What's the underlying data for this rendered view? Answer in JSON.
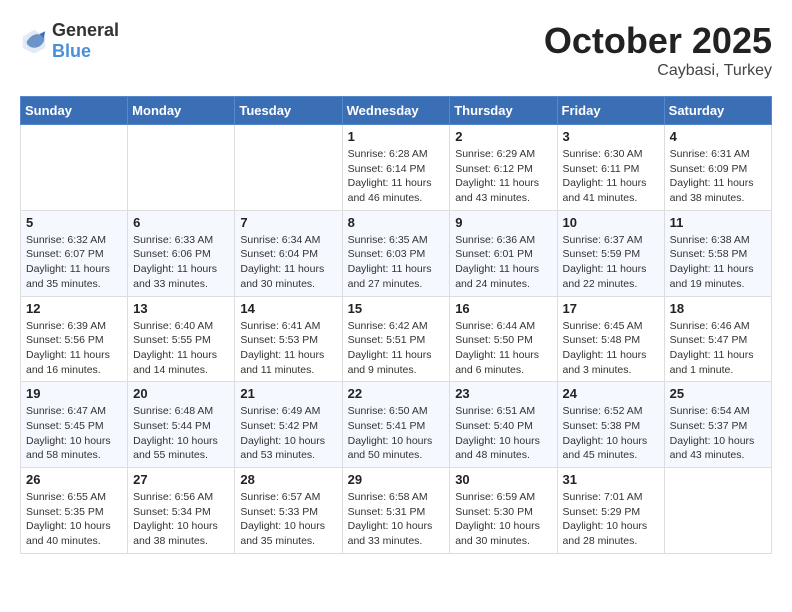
{
  "logo": {
    "general": "General",
    "blue": "Blue"
  },
  "header": {
    "month": "October 2025",
    "location": "Caybasi, Turkey"
  },
  "weekdays": [
    "Sunday",
    "Monday",
    "Tuesday",
    "Wednesday",
    "Thursday",
    "Friday",
    "Saturday"
  ],
  "weeks": [
    [
      {
        "day": "",
        "info": ""
      },
      {
        "day": "",
        "info": ""
      },
      {
        "day": "",
        "info": ""
      },
      {
        "day": "1",
        "info": "Sunrise: 6:28 AM\nSunset: 6:14 PM\nDaylight: 11 hours and 46 minutes."
      },
      {
        "day": "2",
        "info": "Sunrise: 6:29 AM\nSunset: 6:12 PM\nDaylight: 11 hours and 43 minutes."
      },
      {
        "day": "3",
        "info": "Sunrise: 6:30 AM\nSunset: 6:11 PM\nDaylight: 11 hours and 41 minutes."
      },
      {
        "day": "4",
        "info": "Sunrise: 6:31 AM\nSunset: 6:09 PM\nDaylight: 11 hours and 38 minutes."
      }
    ],
    [
      {
        "day": "5",
        "info": "Sunrise: 6:32 AM\nSunset: 6:07 PM\nDaylight: 11 hours and 35 minutes."
      },
      {
        "day": "6",
        "info": "Sunrise: 6:33 AM\nSunset: 6:06 PM\nDaylight: 11 hours and 33 minutes."
      },
      {
        "day": "7",
        "info": "Sunrise: 6:34 AM\nSunset: 6:04 PM\nDaylight: 11 hours and 30 minutes."
      },
      {
        "day": "8",
        "info": "Sunrise: 6:35 AM\nSunset: 6:03 PM\nDaylight: 11 hours and 27 minutes."
      },
      {
        "day": "9",
        "info": "Sunrise: 6:36 AM\nSunset: 6:01 PM\nDaylight: 11 hours and 24 minutes."
      },
      {
        "day": "10",
        "info": "Sunrise: 6:37 AM\nSunset: 5:59 PM\nDaylight: 11 hours and 22 minutes."
      },
      {
        "day": "11",
        "info": "Sunrise: 6:38 AM\nSunset: 5:58 PM\nDaylight: 11 hours and 19 minutes."
      }
    ],
    [
      {
        "day": "12",
        "info": "Sunrise: 6:39 AM\nSunset: 5:56 PM\nDaylight: 11 hours and 16 minutes."
      },
      {
        "day": "13",
        "info": "Sunrise: 6:40 AM\nSunset: 5:55 PM\nDaylight: 11 hours and 14 minutes."
      },
      {
        "day": "14",
        "info": "Sunrise: 6:41 AM\nSunset: 5:53 PM\nDaylight: 11 hours and 11 minutes."
      },
      {
        "day": "15",
        "info": "Sunrise: 6:42 AM\nSunset: 5:51 PM\nDaylight: 11 hours and 9 minutes."
      },
      {
        "day": "16",
        "info": "Sunrise: 6:44 AM\nSunset: 5:50 PM\nDaylight: 11 hours and 6 minutes."
      },
      {
        "day": "17",
        "info": "Sunrise: 6:45 AM\nSunset: 5:48 PM\nDaylight: 11 hours and 3 minutes."
      },
      {
        "day": "18",
        "info": "Sunrise: 6:46 AM\nSunset: 5:47 PM\nDaylight: 11 hours and 1 minute."
      }
    ],
    [
      {
        "day": "19",
        "info": "Sunrise: 6:47 AM\nSunset: 5:45 PM\nDaylight: 10 hours and 58 minutes."
      },
      {
        "day": "20",
        "info": "Sunrise: 6:48 AM\nSunset: 5:44 PM\nDaylight: 10 hours and 55 minutes."
      },
      {
        "day": "21",
        "info": "Sunrise: 6:49 AM\nSunset: 5:42 PM\nDaylight: 10 hours and 53 minutes."
      },
      {
        "day": "22",
        "info": "Sunrise: 6:50 AM\nSunset: 5:41 PM\nDaylight: 10 hours and 50 minutes."
      },
      {
        "day": "23",
        "info": "Sunrise: 6:51 AM\nSunset: 5:40 PM\nDaylight: 10 hours and 48 minutes."
      },
      {
        "day": "24",
        "info": "Sunrise: 6:52 AM\nSunset: 5:38 PM\nDaylight: 10 hours and 45 minutes."
      },
      {
        "day": "25",
        "info": "Sunrise: 6:54 AM\nSunset: 5:37 PM\nDaylight: 10 hours and 43 minutes."
      }
    ],
    [
      {
        "day": "26",
        "info": "Sunrise: 6:55 AM\nSunset: 5:35 PM\nDaylight: 10 hours and 40 minutes."
      },
      {
        "day": "27",
        "info": "Sunrise: 6:56 AM\nSunset: 5:34 PM\nDaylight: 10 hours and 38 minutes."
      },
      {
        "day": "28",
        "info": "Sunrise: 6:57 AM\nSunset: 5:33 PM\nDaylight: 10 hours and 35 minutes."
      },
      {
        "day": "29",
        "info": "Sunrise: 6:58 AM\nSunset: 5:31 PM\nDaylight: 10 hours and 33 minutes."
      },
      {
        "day": "30",
        "info": "Sunrise: 6:59 AM\nSunset: 5:30 PM\nDaylight: 10 hours and 30 minutes."
      },
      {
        "day": "31",
        "info": "Sunrise: 7:01 AM\nSunset: 5:29 PM\nDaylight: 10 hours and 28 minutes."
      },
      {
        "day": "",
        "info": ""
      }
    ]
  ]
}
